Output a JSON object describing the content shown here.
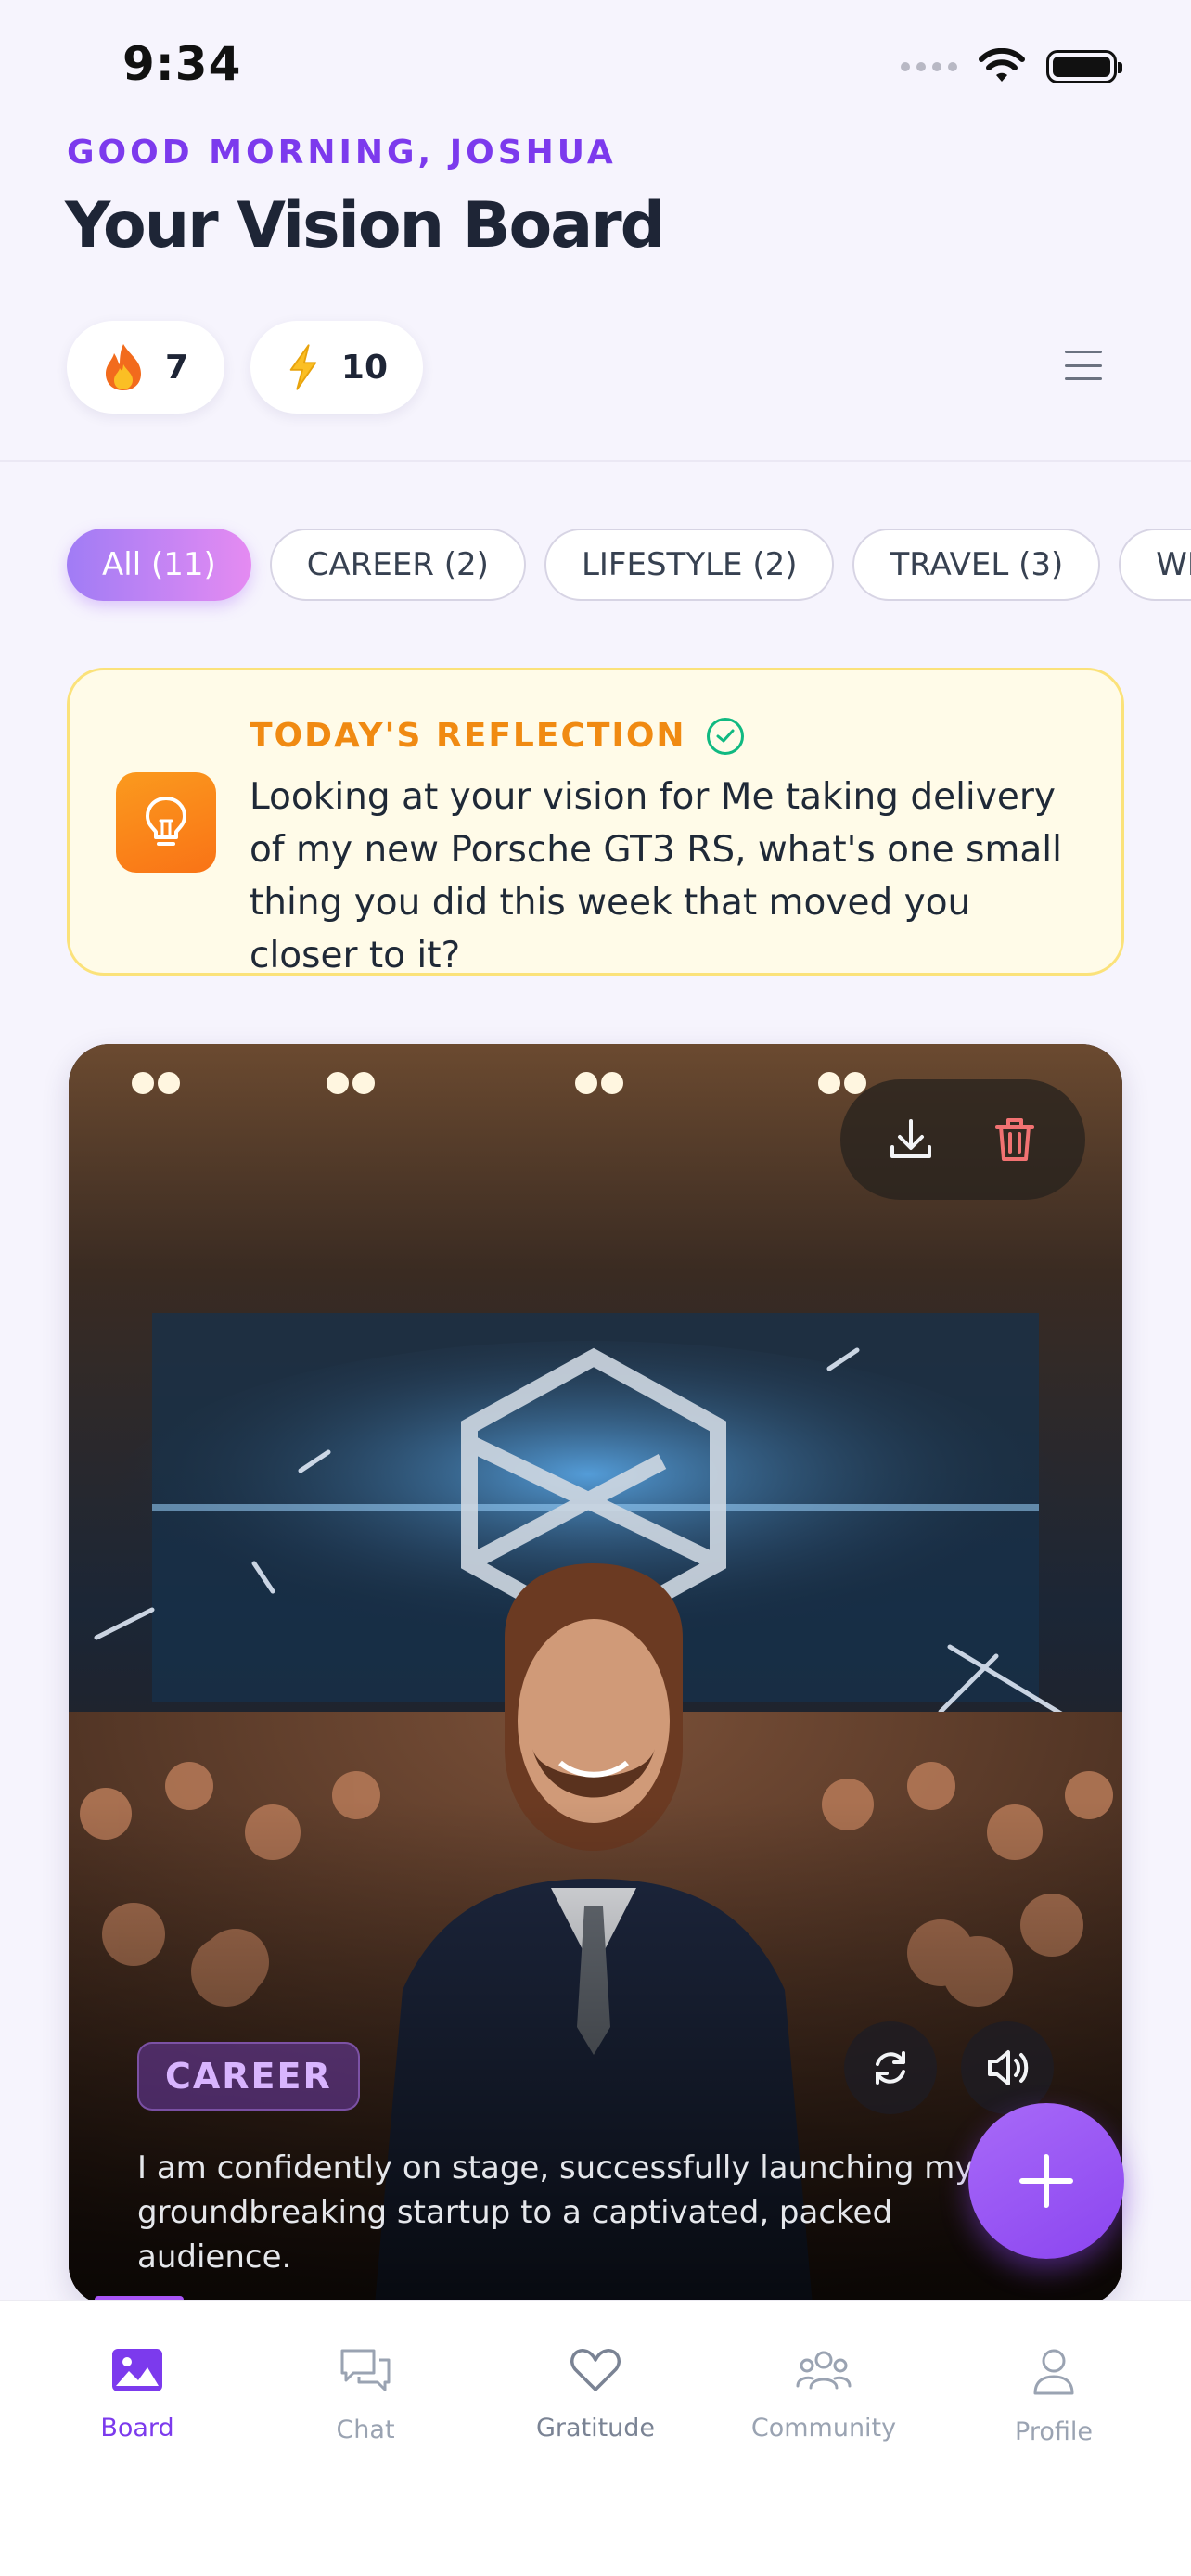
{
  "status_bar": {
    "time": "9:34"
  },
  "header": {
    "greeting": "GOOD MORNING, JOSHUA",
    "title": "Your Vision Board",
    "streak": {
      "icon": "fire-icon",
      "value": "7"
    },
    "energy": {
      "icon": "lightning-icon",
      "value": "10"
    },
    "menu_icon": "hamburger-menu-icon"
  },
  "filters": [
    {
      "label": "All (11)",
      "active": true
    },
    {
      "label": "CAREER (2)",
      "active": false
    },
    {
      "label": "LIFESTYLE (2)",
      "active": false
    },
    {
      "label": "TRAVEL (3)",
      "active": false
    },
    {
      "label": "WEALT",
      "active": false
    }
  ],
  "reflection": {
    "label": "TODAY'S REFLECTION",
    "text": "Looking at your vision for Me taking delivery of my new Porsche GT3 RS, what's one small thing you did this week that moved you closer to it?"
  },
  "vision_card": {
    "category": "CAREER",
    "caption": "I am confidently on stage, successfully launching my groundbreaking startup to a captivated, packed audience."
  },
  "tabs": [
    {
      "label": "Board",
      "icon": "image-icon",
      "active": true
    },
    {
      "label": "Chat",
      "icon": "chat-icon",
      "active": false
    },
    {
      "label": "Gratitude",
      "icon": "heart-icon",
      "active": false
    },
    {
      "label": "Community",
      "icon": "community-icon",
      "active": false
    },
    {
      "label": "Profile",
      "icon": "user-icon",
      "active": false
    }
  ],
  "colors": {
    "accent": "#7c3aed",
    "reflection_label": "#f08a12",
    "reflection_bg": "#fffbe8",
    "fab": "#9b5cf6"
  }
}
